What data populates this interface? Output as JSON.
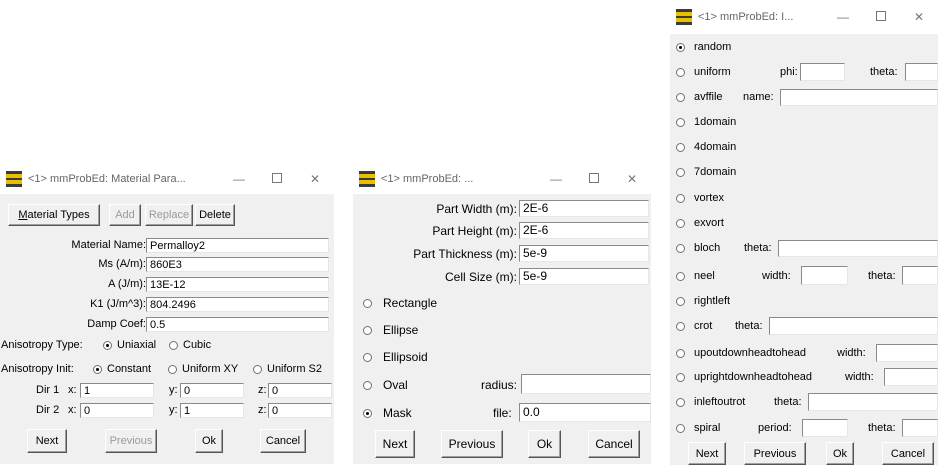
{
  "win1": {
    "title": "<1> mmProbEd: Material Para...",
    "btn_material_types_u": "M",
    "btn_material_types_rest": "aterial Types",
    "btn_add": "Add",
    "btn_replace": "Replace",
    "btn_delete": "Delete",
    "fields": [
      {
        "label": "Material Name:",
        "value": "Permalloy2"
      },
      {
        "label": "Ms (A/m):",
        "value": "860E3"
      },
      {
        "label": "A (J/m):",
        "value": "13E-12"
      },
      {
        "label": "K1 (J/m^3):",
        "value": "804.2496"
      },
      {
        "label": "Damp Coef:",
        "value": "0.5"
      }
    ],
    "aniso_type_label": "Anisotropy Type:",
    "aniso_type_options": [
      "Uniaxial",
      "Cubic"
    ],
    "aniso_type_selected": "Uniaxial",
    "aniso_init_label": "Anisotropy Init:",
    "aniso_init_options": [
      "Constant",
      "Uniform XY",
      "Uniform S2"
    ],
    "aniso_init_selected": "Constant",
    "dir1_label": "Dir 1",
    "dir2_label": "Dir 2",
    "x_label": "x:",
    "y_label": "y:",
    "z_label": "z:",
    "dir1": {
      "x": "1",
      "y": "0",
      "z": "0"
    },
    "dir2": {
      "x": "0",
      "y": "1",
      "z": "0"
    },
    "btn_next": "Next",
    "btn_previous": "Previous",
    "btn_ok": "Ok",
    "btn_cancel": "Cancel"
  },
  "win2": {
    "title": "<1> mmProbEd: ...",
    "fields": [
      {
        "label": "Part Width (m):",
        "value": "2E-6"
      },
      {
        "label": "Part Height (m):",
        "value": "2E-6"
      },
      {
        "label": "Part Thickness (m):",
        "value": "5e-9"
      },
      {
        "label": "Cell Size (m):",
        "value": "5e-9"
      }
    ],
    "shapes": [
      "Rectangle",
      "Ellipse",
      "Ellipsoid",
      "Oval",
      "Mask"
    ],
    "shape_selected": "Mask",
    "radius_label": "radius:",
    "radius_value": "",
    "file_label": "file:",
    "file_value": "0.0",
    "btn_next": "Next",
    "btn_previous": "Previous",
    "btn_ok": "Ok",
    "btn_cancel": "Cancel"
  },
  "win3": {
    "title": "<1> mmProbEd: I...",
    "options": [
      "random",
      "uniform",
      "avffile",
      "1domain",
      "4domain",
      "7domain",
      "vortex",
      "exvort",
      "bloch",
      "neel",
      "rightleft",
      "crot",
      "upoutdownheadtohead",
      "uprightdownheadtohead",
      "inleftoutrot",
      "spiral"
    ],
    "selected": "random",
    "phi_label": "phi:",
    "theta_label": "theta:",
    "name_label": "name:",
    "width_label": "width:",
    "period_label": "period:",
    "btn_next": "Next",
    "btn_previous": "Previous",
    "btn_ok": "Ok",
    "btn_cancel": "Cancel"
  }
}
